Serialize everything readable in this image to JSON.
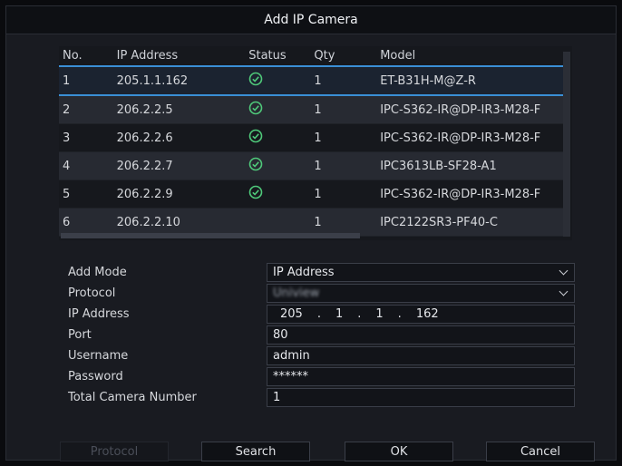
{
  "title": "Add IP Camera",
  "table": {
    "headers": [
      "No.",
      "IP Address",
      "Status",
      "Qty",
      "Model"
    ],
    "rows": [
      {
        "no": "1",
        "ip": "205.1.1.162",
        "status": "ok",
        "qty": "1",
        "model": "ET-B31H-M@Z-R"
      },
      {
        "no": "2",
        "ip": "206.2.2.5",
        "status": "ok",
        "qty": "1",
        "model": "IPC-S362-IR@DP-IR3-M28-F"
      },
      {
        "no": "3",
        "ip": "206.2.2.6",
        "status": "ok",
        "qty": "1",
        "model": "IPC-S362-IR@DP-IR3-M28-F"
      },
      {
        "no": "4",
        "ip": "206.2.2.7",
        "status": "ok",
        "qty": "1",
        "model": "IPC3613LB-SF28-A1"
      },
      {
        "no": "5",
        "ip": "206.2.2.9",
        "status": "ok",
        "qty": "1",
        "model": "IPC-S362-IR@DP-IR3-M28-F"
      },
      {
        "no": "6",
        "ip": "206.2.2.10",
        "status": "",
        "qty": "1",
        "model": "IPC2122SR3-PF40-C"
      }
    ]
  },
  "form": {
    "add_mode_label": "Add Mode",
    "add_mode_value": "IP Address",
    "protocol_label": "Protocol",
    "protocol_value": "Uniview",
    "ip_label": "IP Address",
    "ip_octets": [
      "205",
      "1",
      "1",
      "162"
    ],
    "ip_dot": ".",
    "port_label": "Port",
    "port_value": "80",
    "username_label": "Username",
    "username_value": "admin",
    "password_label": "Password",
    "password_value": "******",
    "total_label": "Total Camera Number",
    "total_value": "1"
  },
  "buttons": {
    "protocol": "Protocol",
    "search": "Search",
    "ok": "OK",
    "cancel": "Cancel"
  },
  "colors": {
    "accent": "#3a8fd6",
    "status_ok": "#4fc97a"
  }
}
